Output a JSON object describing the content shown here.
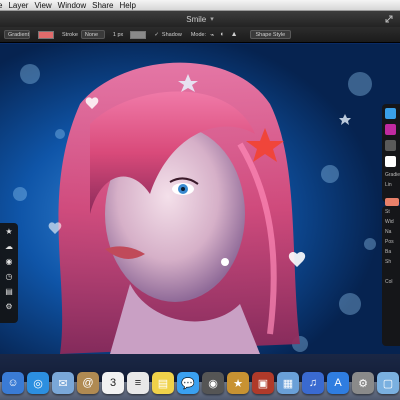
{
  "menubar": {
    "items": [
      "e",
      "Layer",
      "View",
      "Window",
      "Share",
      "Help"
    ]
  },
  "window": {
    "title": "Smile"
  },
  "toolbar": {
    "fill_select": "Gradient",
    "fill_color": "#e06b6b",
    "stroke_label": "Stroke",
    "stroke_select": "None",
    "stroke_width": "1 px",
    "stroke_color": "#8a8a8a",
    "shadow_label": "Shadow",
    "mode_label": "Mode:",
    "shape_style_button": "Shape Style"
  },
  "left_palette": {
    "tools": [
      "star-icon",
      "cloud-icon",
      "eye-icon",
      "clock-icon",
      "document-icon",
      "gear-icon"
    ]
  },
  "right_palette_top": {
    "swatches": [
      "#3aa0e8",
      "#c02aa0",
      "#5a5a5a",
      "#ffffff"
    ],
    "label1": "Gradie",
    "label2": "Lin",
    "current_color": "#e8806a"
  },
  "right_palette_bottom": {
    "rows": [
      "St",
      "Wid",
      "Na",
      "Pos",
      "Ba",
      "Sh",
      "",
      "Col"
    ]
  },
  "dock": {
    "icons": [
      {
        "name": "finder-icon",
        "color": "#3a7bd5",
        "glyph": "☺"
      },
      {
        "name": "safari-icon",
        "color": "#2c8fe0",
        "glyph": "◎"
      },
      {
        "name": "mail-icon",
        "color": "#7aa7d8",
        "glyph": "✉"
      },
      {
        "name": "address-book-icon",
        "color": "#b08a52",
        "glyph": "@"
      },
      {
        "name": "calendar-icon",
        "color": "#f2f2f2",
        "glyph": "3"
      },
      {
        "name": "textedit-icon",
        "color": "#e8e8e8",
        "glyph": "≡"
      },
      {
        "name": "stickies-icon",
        "color": "#f0d24a",
        "glyph": "▤"
      },
      {
        "name": "messages-icon",
        "color": "#3aa0f0",
        "glyph": "💬"
      },
      {
        "name": "facetime-icon",
        "color": "#555555",
        "glyph": "◉"
      },
      {
        "name": "photo-booth-icon",
        "color": "#c89232",
        "glyph": "★"
      },
      {
        "name": "photo-app-icon",
        "color": "#b03a2a",
        "glyph": "▣"
      },
      {
        "name": "iphoto-icon",
        "color": "#6aa0d8",
        "glyph": "▦"
      },
      {
        "name": "itunes-icon",
        "color": "#3a6ad0",
        "glyph": "♫"
      },
      {
        "name": "app-store-icon",
        "color": "#2f7de0",
        "glyph": "A"
      },
      {
        "name": "preferences-icon",
        "color": "#8a8a8a",
        "glyph": "⚙"
      },
      {
        "name": "folder-icon",
        "color": "#7ab0e0",
        "glyph": "▢"
      }
    ]
  }
}
